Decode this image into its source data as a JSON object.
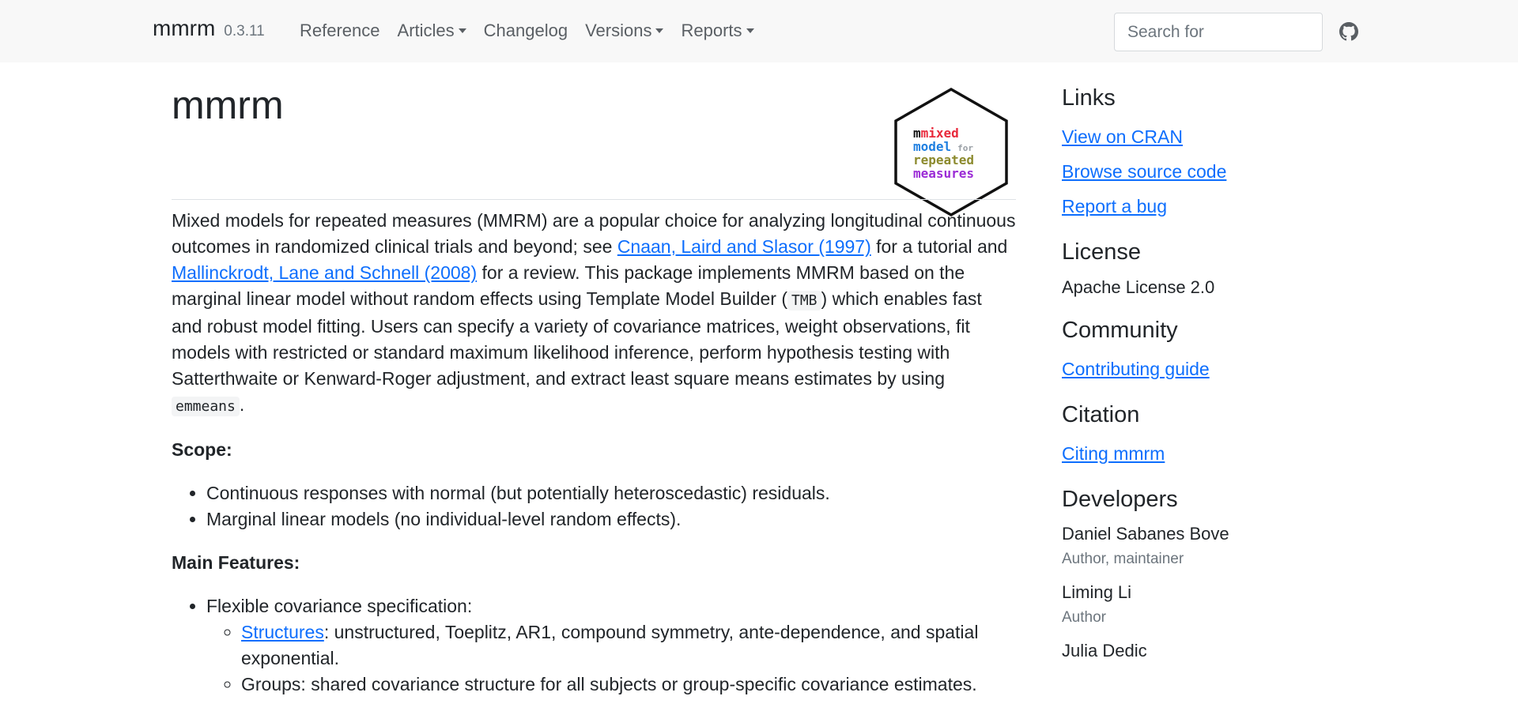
{
  "navbar": {
    "brand": "mmrm",
    "version": "0.3.11",
    "items": [
      {
        "label": "Reference",
        "dropdown": false
      },
      {
        "label": "Articles",
        "dropdown": true
      },
      {
        "label": "Changelog",
        "dropdown": false
      },
      {
        "label": "Versions",
        "dropdown": true
      },
      {
        "label": "Reports",
        "dropdown": true
      }
    ],
    "search_placeholder": "Search for",
    "github_icon": "github-icon"
  },
  "main": {
    "title": "mmrm",
    "logo": {
      "line1": "mixed",
      "line2": "model",
      "line2_suffix": "for",
      "line3": "repeated",
      "line4": "measures",
      "colors": {
        "mixed": "#e8293b",
        "model": "#1f7fe0",
        "for": "#9aa0a6",
        "repeated": "#8c8a2e",
        "measures": "#9b2bd6",
        "initial": "#111111"
      }
    },
    "intro": {
      "t1": "Mixed models for repeated measures (MMRM) are a popular choice for analyzing longitudinal continuous outcomes in randomized clinical trials and beyond; see ",
      "link1": "Cnaan, Laird and Slasor (1997)",
      "t2": " for a tutorial and ",
      "link2": "Mallinckrodt, Lane and Schnell (2008)",
      "t3": " for a review. This package implements MMRM based on the marginal linear model without random effects using Template Model Builder (",
      "code1": "TMB",
      "t4": ") which enables fast and robust model fitting. Users can specify a variety of covariance matrices, weight observations, fit models with restricted or standard maximum likelihood inference, perform hypothesis testing with Satterthwaite or Kenward-Roger adjustment, and extract least square means estimates by using ",
      "code2": "emmeans",
      "t5": "."
    },
    "scope_heading": "Scope:",
    "scope_items": [
      "Continuous responses with normal (but potentially heteroscedastic) residuals.",
      "Marginal linear models (no individual-level random effects)."
    ],
    "features_heading": "Main Features:",
    "features": {
      "item1": "Flexible covariance specification:",
      "sub1_link": "Structures",
      "sub1_text": ": unstructured, Toeplitz, AR1, compound symmetry, ante-dependence, and spatial exponential.",
      "sub2_text": "Groups: shared covariance structure for all subjects or group-specific covariance estimates."
    }
  },
  "sidebar": {
    "links_heading": "Links",
    "links": [
      "View on CRAN",
      "Browse source code",
      "Report a bug"
    ],
    "license_heading": "License",
    "license": "Apache License 2.0",
    "community_heading": "Community",
    "community_link": "Contributing guide",
    "citation_heading": "Citation",
    "citation_link": "Citing mmrm",
    "developers_heading": "Developers",
    "developers": [
      {
        "name": "Daniel Sabanes Bove",
        "role": "Author, maintainer"
      },
      {
        "name": "Liming Li",
        "role": "Author"
      },
      {
        "name": "Julia Dedic",
        "role": ""
      }
    ]
  }
}
